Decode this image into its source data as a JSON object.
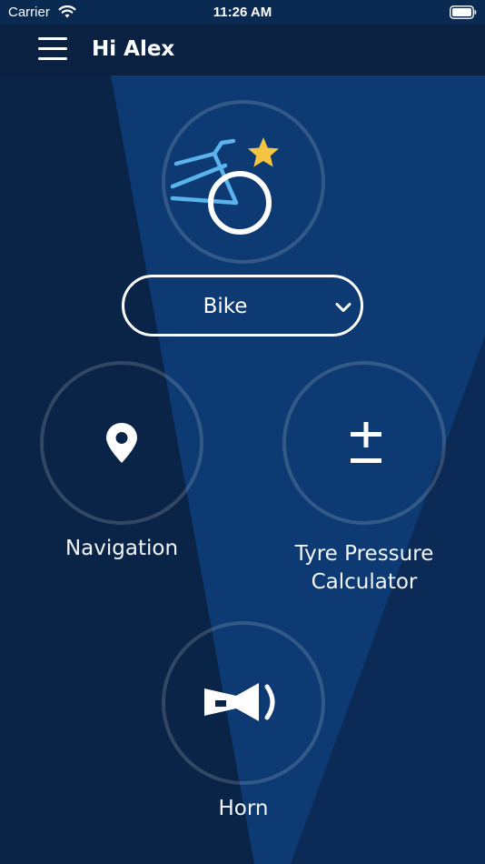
{
  "status_bar": {
    "carrier": "Carrier",
    "time": "11:26 AM"
  },
  "header": {
    "greeting": "Hi Alex"
  },
  "vehicle": {
    "selected": "Bike"
  },
  "features": {
    "navigation": {
      "label": "Navigation",
      "icon": "location-pin-icon"
    },
    "tyre_pressure": {
      "label": "Tyre Pressure\nCalculator",
      "icon": "plus-minus-icon"
    },
    "horn": {
      "label": "Horn",
      "icon": "horn-icon"
    }
  },
  "colors": {
    "background_dark": "#0a2447",
    "background_light": "#0d3a73",
    "bike_blue": "#5ab3ea",
    "star_yellow": "#f5c542",
    "text": "#ffffff"
  }
}
